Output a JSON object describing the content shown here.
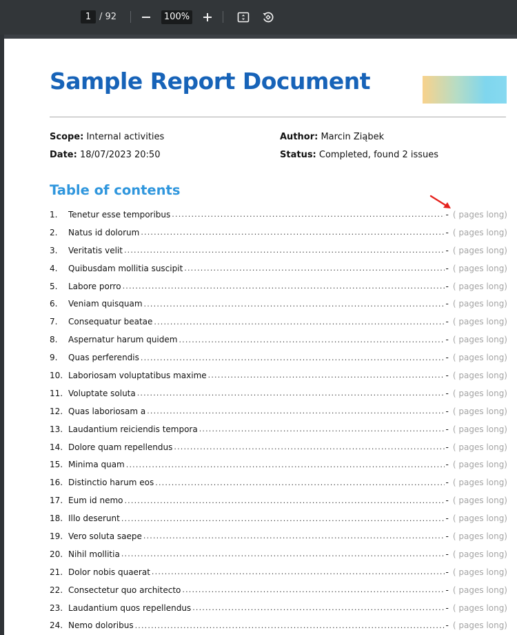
{
  "toolbar": {
    "page_current": "1",
    "page_total": "/ 92",
    "zoom": "100%",
    "icons": [
      "zoom-out-icon",
      "zoom-in-icon",
      "fit-page-icon",
      "rotate-icon"
    ]
  },
  "document": {
    "title": "Sample Report Document",
    "scope_label": "Scope:",
    "scope_value": "Internal activities",
    "date_label": "Date:",
    "date_value": "18/07/2023 20:50",
    "author_label": "Author:",
    "author_value": "Marcin Ziąbek",
    "status_label": "Status:",
    "status_value": "Completed, found 2 issues",
    "toc_heading": "Table of contents",
    "toc_dash": "-",
    "toc_pages_text": "( pages long)",
    "toc": [
      {
        "num": "1.",
        "title": "Tenetur esse temporibus"
      },
      {
        "num": "2.",
        "title": "Natus id dolorum"
      },
      {
        "num": "3.",
        "title": "Veritatis velit"
      },
      {
        "num": "4.",
        "title": "Quibusdam mollitia suscipit"
      },
      {
        "num": "5.",
        "title": "Labore porro"
      },
      {
        "num": "6.",
        "title": "Veniam quisquam"
      },
      {
        "num": "7.",
        "title": "Consequatur beatae"
      },
      {
        "num": "8.",
        "title": "Aspernatur harum quidem"
      },
      {
        "num": "9.",
        "title": "Quas perferendis"
      },
      {
        "num": "10.",
        "title": "Laboriosam voluptatibus maxime"
      },
      {
        "num": "11.",
        "title": "Voluptate soluta"
      },
      {
        "num": "12.",
        "title": "Quas laboriosam a"
      },
      {
        "num": "13.",
        "title": "Laudantium reiciendis tempora"
      },
      {
        "num": "14.",
        "title": "Dolore quam repellendus"
      },
      {
        "num": "15.",
        "title": "Minima quam"
      },
      {
        "num": "16.",
        "title": "Distinctio harum eos"
      },
      {
        "num": "17.",
        "title": "Eum id nemo"
      },
      {
        "num": "18.",
        "title": "Illo deserunt"
      },
      {
        "num": "19.",
        "title": "Vero soluta saepe"
      },
      {
        "num": "20.",
        "title": "Nihil mollitia"
      },
      {
        "num": "21.",
        "title": "Dolor nobis quaerat"
      },
      {
        "num": "22.",
        "title": "Consectetur quo architecto"
      },
      {
        "num": "23.",
        "title": "Laudantium quos repellendus"
      },
      {
        "num": "24.",
        "title": "Nemo doloribus"
      }
    ]
  },
  "colors": {
    "title": "#1763b8",
    "toc_heading": "#2f96dd",
    "pages_text": "#a4a4a4",
    "toolbar": "#323639",
    "annotation_arrow": "#e5211c"
  }
}
